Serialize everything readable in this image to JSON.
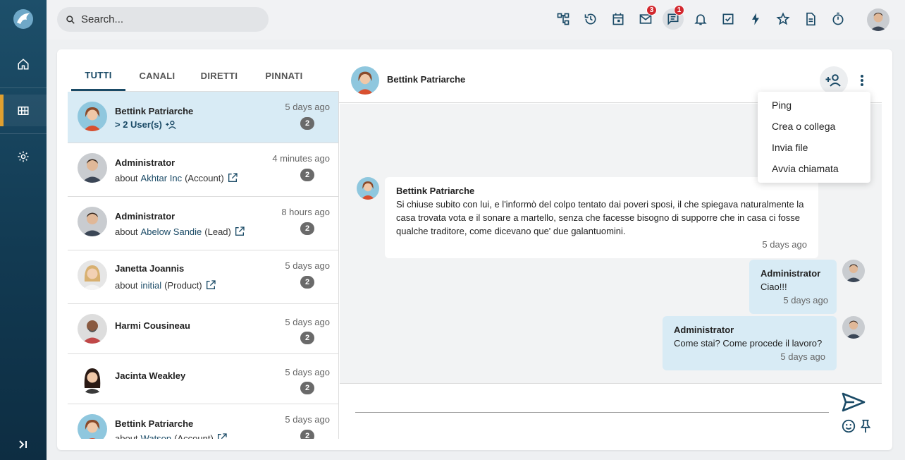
{
  "search": {
    "placeholder": "Search..."
  },
  "toolbar": {
    "icons": [
      "sitemap-icon",
      "history-icon",
      "calendar-icon",
      "mail-icon",
      "chat-icon",
      "bell-icon",
      "task-check-icon",
      "bolt-icon",
      "star-icon",
      "document-icon",
      "timer-icon"
    ],
    "mail_badge": "3",
    "chat_badge": "1"
  },
  "tabs": [
    {
      "label": "TUTTI",
      "active": true
    },
    {
      "label": "CANALI"
    },
    {
      "label": "DIRETTI"
    },
    {
      "label": "PINNATI"
    }
  ],
  "conversations": [
    {
      "name": "Bettink Patriarche",
      "sub_prefix": "> 2 User(s)",
      "time": "5 days ago",
      "count": "2",
      "selected": true
    },
    {
      "name": "Administrator",
      "sub_prefix": "about",
      "sub_link": "Akhtar Inc",
      "sub_suffix": "(Account)",
      "time": "4 minutes ago",
      "count": "2"
    },
    {
      "name": "Administrator",
      "sub_prefix": "about",
      "sub_link": "Abelow Sandie",
      "sub_suffix": "(Lead)",
      "time": "8 hours ago",
      "count": "2"
    },
    {
      "name": "Janetta Joannis",
      "sub_prefix": "about",
      "sub_link": "initial",
      "sub_suffix": "(Product)",
      "time": "5 days ago",
      "count": "2"
    },
    {
      "name": "Harmi Cousineau",
      "time": "5 days ago",
      "count": "2"
    },
    {
      "name": "Jacinta Weakley",
      "time": "5 days ago",
      "count": "2"
    },
    {
      "name": "Bettink Patriarche",
      "sub_prefix": "about",
      "sub_link": "Watson",
      "sub_suffix": "(Account)",
      "time": "5 days ago",
      "count": "2"
    }
  ],
  "chat": {
    "title": "Bettink Patriarche",
    "messages": [
      {
        "author": "Bettink Patriarche",
        "text": "Si chiuse subito con lui, e l'informò del colpo tentato dai poveri sposi, il che spiegava naturalmente la casa trovata vota e il sonare a martello, senza che facesse bisogno di supporre che in casa ci fosse qualche traditore, come dicevano que' due galantuomini.",
        "time": "5 days ago"
      },
      {
        "author": "Administrator",
        "text": "Ciao!!!",
        "time": "5 days ago"
      },
      {
        "author": "Administrator",
        "text": "Come stai? Come procede il lavoro?",
        "time": "5 days ago"
      }
    ]
  },
  "menu": [
    "Ping",
    "Crea o collega",
    "Invia file",
    "Avvia chiamata"
  ],
  "colors": {
    "accent": "#1a4a66",
    "selected_bg": "#d8ebf5",
    "badge": "#d2282e",
    "rail_active": "#e0a030"
  }
}
